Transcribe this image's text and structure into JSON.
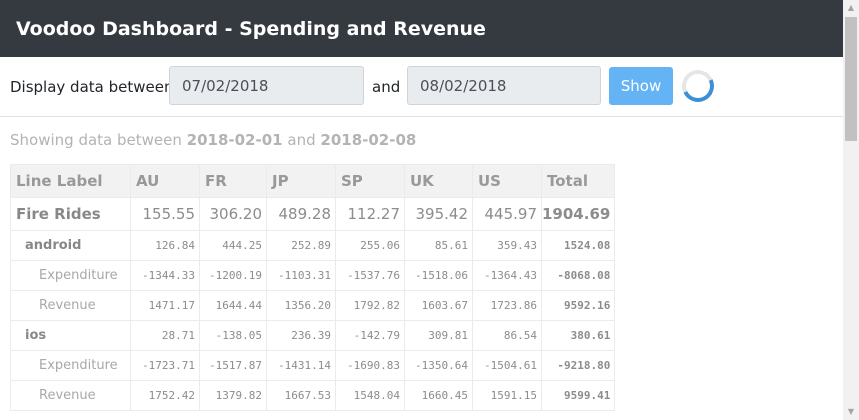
{
  "header": {
    "title": "Voodoo Dashboard - Spending and Revenue"
  },
  "filter": {
    "display_label": "Display data between",
    "from_value": "07/02/2018",
    "and_label": "and",
    "to_value": "08/02/2018",
    "show_label": "Show"
  },
  "summary": {
    "prefix": "Showing data between",
    "start": "2018-02-01",
    "middle": "and",
    "end": "2018-02-08"
  },
  "table": {
    "columns": [
      "Line Label",
      "AU",
      "FR",
      "JP",
      "SP",
      "UK",
      "US",
      "Total"
    ],
    "rows": [
      {
        "level": 0,
        "label": "Fire Rides",
        "values": [
          "155.55",
          "306.20",
          "489.28",
          "112.27",
          "395.42",
          "445.97"
        ],
        "total": "1904.69"
      },
      {
        "level": 1,
        "label": "android",
        "values": [
          "126.84",
          "444.25",
          "252.89",
          "255.06",
          "85.61",
          "359.43"
        ],
        "total": "1524.08"
      },
      {
        "level": 2,
        "label": "Expenditure",
        "values": [
          "-1344.33",
          "-1200.19",
          "-1103.31",
          "-1537.76",
          "-1518.06",
          "-1364.43"
        ],
        "total": "-8068.08"
      },
      {
        "level": 2,
        "label": "Revenue",
        "values": [
          "1471.17",
          "1644.44",
          "1356.20",
          "1792.82",
          "1603.67",
          "1723.86"
        ],
        "total": "9592.16"
      },
      {
        "level": 1,
        "label": "ios",
        "values": [
          "28.71",
          "-138.05",
          "236.39",
          "-142.79",
          "309.81",
          "86.54"
        ],
        "total": "380.61"
      },
      {
        "level": 2,
        "label": "Expenditure",
        "values": [
          "-1723.71",
          "-1517.87",
          "-1431.14",
          "-1690.83",
          "-1350.64",
          "-1504.61"
        ],
        "total": "-9218.80"
      },
      {
        "level": 2,
        "label": "Revenue",
        "values": [
          "1752.42",
          "1379.82",
          "1667.53",
          "1548.04",
          "1660.45",
          "1591.15"
        ],
        "total": "9599.41"
      }
    ]
  }
}
